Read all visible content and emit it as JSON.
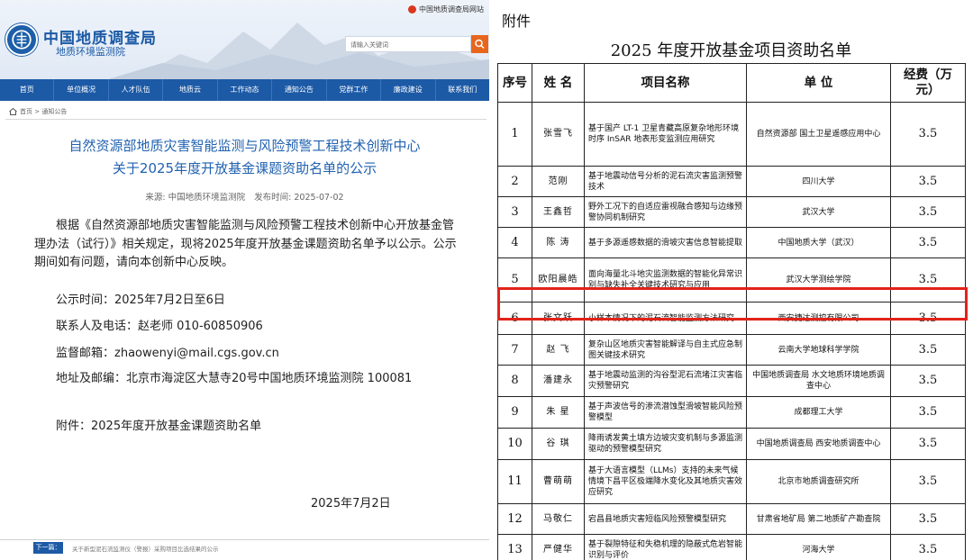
{
  "header": {
    "top_link": "中国地质调查局网站",
    "site_name": "中国地质调查局",
    "site_sub": "地质环境监测院",
    "search_placeholder": "请输入关键词"
  },
  "nav": [
    "首页",
    "单位概况",
    "人才队伍",
    "地质云",
    "工作动态",
    "通知公告",
    "党群工作",
    "廉政建设",
    "联系我们"
  ],
  "breadcrumb": "首页 > 通知公告",
  "article": {
    "title_line1": "自然资源部地质灾害智能监测与风险预警工程技术创新中心",
    "title_line2": "关于2025年度开放基金课题资助名单的公示",
    "source": "来源: 中国地质环境监测院",
    "date": "发布时间: 2025-07-02",
    "para1": "根据《自然资源部地质灾害智能监测与风险预警工程技术创新中心开放基金管理办法（试行）》相关规定，现将2025年度开放基金课题资助名单予以公示。公示期间如有问题，请向本创新中心反映。",
    "period": "公示时间：2025年7月2日至6日",
    "contact": "联系人及电话：赵老师 010-60850906",
    "email": "监督邮箱：zhaowenyi@mail.cgs.gov.cn",
    "address": "地址及邮编：北京市海淀区大慧寺20号中国地质环境监测院  100081",
    "attachment": "附件：2025年度开放基金课题资助名单",
    "sign_date": "2025年7月2日"
  },
  "footer": {
    "next_label": "下一篇：",
    "next_title": "关于新型泥石流监测仪（警报）采购项目比选结果的公示"
  },
  "document": {
    "annex_label": "附件",
    "title": "2025 年度开放基金项目资助名单",
    "columns": [
      "序号",
      "姓 名",
      "项目名称",
      "单 位",
      "经费（万元）"
    ],
    "rows": [
      {
        "no": "1",
        "name": "张雪飞",
        "project": "基于国产 LT-1 卫星青藏高原复杂地形环境时序 InSAR 地表形变监测应用研究",
        "unit": "自然资源部 国土卫星遥感应用中心",
        "fee": "3.5"
      },
      {
        "no": "2",
        "name": "范刚",
        "project": "基于地震动信号分析的泥石流灾害监测预警技术",
        "unit": "四川大学",
        "fee": "3.5"
      },
      {
        "no": "3",
        "name": "王鑫哲",
        "project": "野外工况下的自适应雷视融合感知与边缘预警协同机制研究",
        "unit": "武汉大学",
        "fee": "3.5"
      },
      {
        "no": "4",
        "name": "陈 涛",
        "project": "基于多源遥感数据的滑坡灾害信息智能提取",
        "unit": "中国地质大学（武汉）",
        "fee": "3.5"
      },
      {
        "no": "5",
        "name": "欧阳晨皓",
        "project": "面向海量北斗地灾监测数据的智能化异常识别与缺失补全关键技术研究与应用",
        "unit": "武汉大学测绘学院",
        "fee": "3.5"
      },
      {
        "no": "6",
        "name": "张文跃",
        "project": "小样本情况下的泥石流智能监测方法研究",
        "unit": "西安捷达测控有限公司",
        "fee": "3.5"
      },
      {
        "no": "7",
        "name": "赵 飞",
        "project": "复杂山区地质灾害智能解译与自主式应急制图关键技术研究",
        "unit": "云南大学地球科学学院",
        "fee": "3.5"
      },
      {
        "no": "8",
        "name": "潘建永",
        "project": "基于地震动监测的沟谷型泥石流堵江灾害临灾预警研究",
        "unit": "中国地质调查局 水文地质环境地质调查中心",
        "fee": "3.5"
      },
      {
        "no": "9",
        "name": "朱 星",
        "project": "基于声波信号的渗流潜蚀型滑坡智能风险预警模型",
        "unit": "成都理工大学",
        "fee": "3.5"
      },
      {
        "no": "10",
        "name": "谷 琪",
        "project": "降雨诱发黄土填方边坡灾变机制与多源监测驱动的预警模型研究",
        "unit": "中国地质调查局 西安地质调查中心",
        "fee": "3.5"
      },
      {
        "no": "11",
        "name": "曹萌萌",
        "project": "基于大语言模型（LLMs）支持的未来气候情境下昌平区极端降水变化及其地质灾害效应研究",
        "unit": "北京市地质调查研究所",
        "fee": "3.5"
      },
      {
        "no": "12",
        "name": "马敬仁",
        "project": "宕昌县地质灾害短临风险预警模型研究",
        "unit": "甘肃省地矿局 第二地质矿产勘查院",
        "fee": "3.5"
      },
      {
        "no": "13",
        "name": "严健华",
        "project": "基于裂隙特征和失稳机理的隐蔽式危岩智能识别与评价",
        "unit": "河海大学",
        "fee": "3.5"
      }
    ]
  },
  "colors": {
    "nav_bg": "#1c5aa6",
    "title_blue": "#2162b0",
    "highlight": "#e2231a",
    "search_btn": "#e7661e"
  }
}
